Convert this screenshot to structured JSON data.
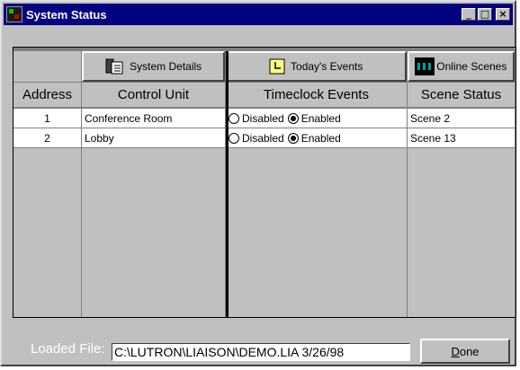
{
  "window": {
    "title": "System Status"
  },
  "toolbar": {
    "system_details": "System Details",
    "todays_events": "Today's Events",
    "online_scenes": "Online Scenes"
  },
  "columns": [
    "Address",
    "Control Unit",
    "Timeclock Events",
    "Scene Status"
  ],
  "rows": [
    {
      "address": "1",
      "control_unit": "Conference Room",
      "disabled_label": "Disabled",
      "enabled_label": "Enabled",
      "selected": "Enabled",
      "scene": "Scene 2"
    },
    {
      "address": "2",
      "control_unit": "Lobby",
      "disabled_label": "Disabled",
      "enabled_label": "Enabled",
      "selected": "Enabled",
      "scene": "Scene 13"
    }
  ],
  "footer": {
    "loaded_label": "Loaded File:",
    "file_path": "C:\\LUTRON\\LIAISON\\DEMO.LIA    3/26/98",
    "done_label": "Done"
  },
  "colors": {
    "titlebar": "#000080",
    "window": "#c0c0c0",
    "grid_bg": "#808080"
  }
}
